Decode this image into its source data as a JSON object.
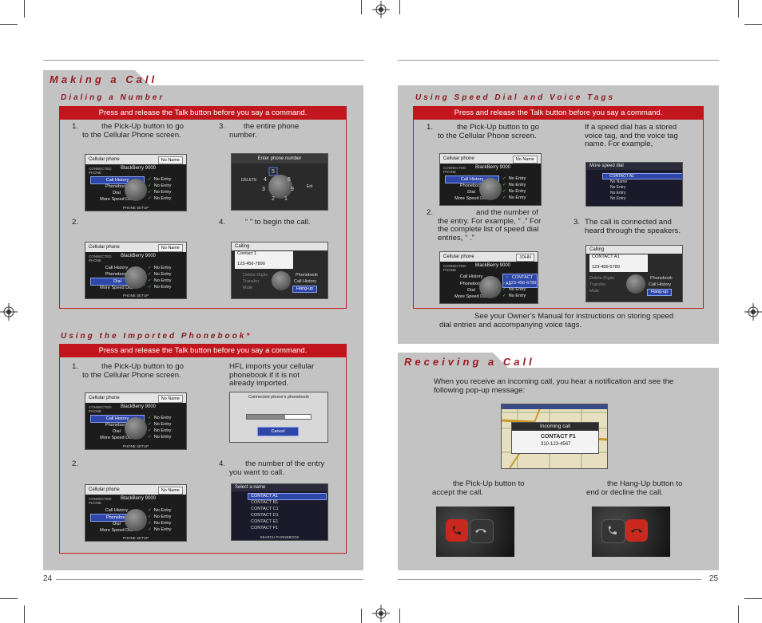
{
  "page_left": "24",
  "page_right": "25",
  "sections": {
    "making_call": {
      "title": "Making a Call",
      "dialing": {
        "title": "Dialing a Number",
        "instruction": "Press and release the Talk button before you say a command.",
        "step1_num": "1.",
        "step1": "the Pick-Up button to go to the Cellular Phone screen.",
        "step2_num": "2.",
        "step3_num": "3.",
        "step3": "the entire phone number.",
        "step4_num": "4.",
        "step4": "“ ” to begin the call."
      },
      "phonebook": {
        "title": "Using the Imported Phonebook",
        "star": "*",
        "instruction": "Press and release the Talk button before you say a command.",
        "step1_num": "1.",
        "step1": "the Pick-Up button to go to the Cellular Phone screen.",
        "note": "HFL imports your cellular phonebook if it is not already imported.",
        "step2_num": "2.",
        "step4_num": "4.",
        "step4": "the number of the entry you want to call."
      }
    },
    "speed_dial": {
      "title": "Using Speed Dial and Voice Tags",
      "instruction": "Press and release the Talk button before you say a command.",
      "step1_num": "1.",
      "step1": "the Pick-Up button to go to the Cellular Phone screen.",
      "note": "If a speed dial has a stored voice tag, and the voice tag name. For example,",
      "step2_num": "2.",
      "step2": "and the number of the entry. For example, “ .” For the complete list of speed dial entries, “ .”",
      "step3_num": "3.",
      "step3": "The call is connected and heard through the speakers.",
      "footnote": "See your Owner’s Manual for instructions on storing speed dial entries and accompanying voice tags."
    },
    "receiving": {
      "title": "Receiving a Call",
      "intro": "When you receive an incoming call, you hear a notification and see the following pop-up message:",
      "accept": "the Pick-Up button to accept the call.",
      "decline": "the Hang-Up button to end or decline the call."
    }
  },
  "screens": {
    "cell_header": "Cellular phone",
    "no_name": "No Name",
    "phone_name": "BlackBerry 9000",
    "connected": "CONNECTED PHONE",
    "menu": [
      "Call History",
      "Phonebook",
      "Dial",
      "More Speed Dial"
    ],
    "entries": [
      "No Entry",
      "No Entry",
      "No Entry",
      "No Entry"
    ],
    "phone_setup": "PHONE SETUP",
    "enter_phone": "Enter phone number",
    "calling": "Calling",
    "contact1": "Contact 1",
    "contact1_num": "123-456-7890",
    "call_opts": [
      "Phonebook",
      "Call History",
      "Hang-up"
    ],
    "call_left_opts": [
      "Delete Digits",
      "Transfer",
      "Mute"
    ],
    "importing": "Connected phone's phonebook",
    "cancel": "Cancel",
    "select_name": "Select a name",
    "contacts": [
      "CONTACT A1",
      "CONTACT B1",
      "CONTACT C1",
      "CONTACT D1",
      "CONTACT E1",
      "CONTACT F1"
    ],
    "search_phonebook": "SEARCH PHONEBOOK",
    "more_speed": "More speed dial",
    "speed_list": [
      "CONTACT A1",
      "No Name",
      "No Entry",
      "No Entry",
      "No Entry",
      "No Entry",
      "No Entry"
    ],
    "john": "JOHN",
    "contact_a1_num": "123-456-6789",
    "contact_a1": "CONTACT A1",
    "incoming": "Incoming call",
    "contact_f1": "CONTACT F1",
    "contact_f1_num": "310-123-4567"
  }
}
